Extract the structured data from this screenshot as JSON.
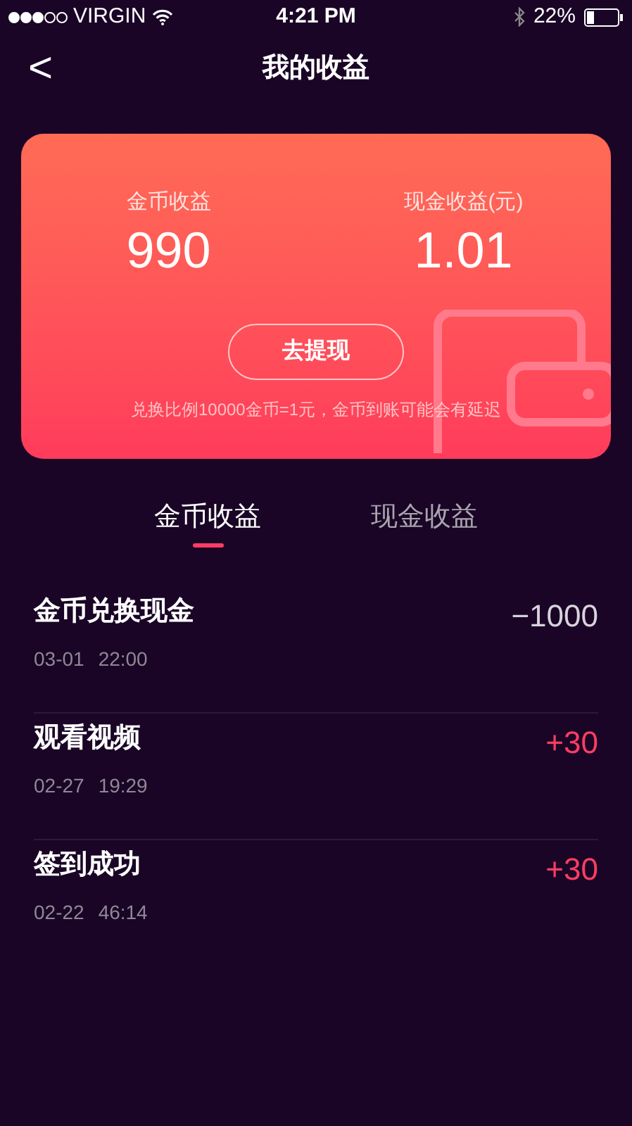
{
  "status_bar": {
    "carrier": "VIRGIN",
    "time": "4:21 PM",
    "battery": "22%"
  },
  "nav": {
    "back": "<",
    "title": "我的收益"
  },
  "summary": {
    "stats": [
      {
        "label": "金币收益",
        "value": "990"
      },
      {
        "label": "现金收益(元)",
        "value": "1.01"
      }
    ],
    "button": "去提现",
    "note": "兑换比例10000金币=1元，金币到账可能会有延迟"
  },
  "tabs": [
    {
      "label": "金币收益",
      "selected": true
    },
    {
      "label": "现金收益",
      "selected": false
    }
  ],
  "records": [
    {
      "title": "金币兑换现金",
      "date": "03-01",
      "time": "22:00",
      "amount": "−1000",
      "kind": "debit"
    },
    {
      "title": "观看视频",
      "date": "02-27",
      "time": "19:29",
      "amount": "+30",
      "kind": "credit"
    },
    {
      "title": "签到成功",
      "date": "02-22",
      "time": "46:14",
      "amount": "+30",
      "kind": "credit"
    }
  ]
}
